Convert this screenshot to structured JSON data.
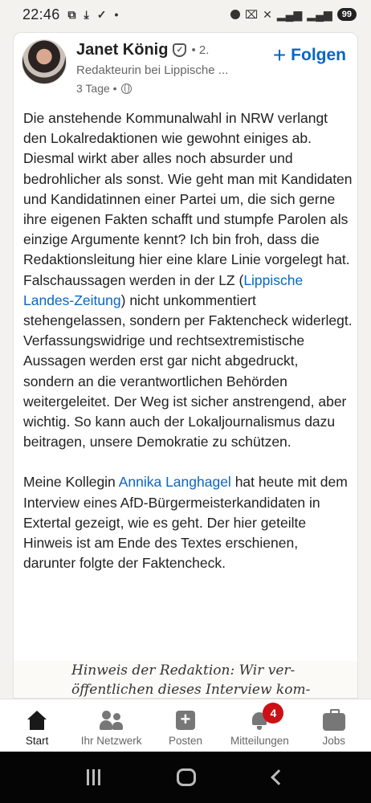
{
  "status_bar": {
    "time": "22:46",
    "battery": "99"
  },
  "post": {
    "author": {
      "name": "Janet König",
      "degree": "• 2.",
      "headline": "Redakteurin bei Lippische ...",
      "time": "3 Tage •"
    },
    "follow_label": "Folgen",
    "text": {
      "p1_a": "Die anstehende Kommunalwahl in NRW verlangt den Lokalredaktionen wie gewohnt einiges ab. Diesmal wirkt aber alles noch absurder und bedrohlicher als sonst. Wie geht man mit Kandidaten und Kandidatinnen einer Partei um, die sich gerne ihre eigenen Fakten schafft und stumpfe Parolen als einzige Argumente kennt? Ich bin froh, dass die Redaktionsleitung hier eine klare Linie vorgelegt hat. Falschaussagen werden in der LZ (",
      "p1_link": "Lippische Landes-Zeitung",
      "p1_b": ") nicht unkommentiert stehengelassen, sondern per Faktencheck widerlegt. Verfassungswidrige und rechtsextremistische Aussagen werden erst gar nicht abgedruckt, sondern an die verantwortlichen Behörden weitergeleitet. Der Weg ist sicher anstrengend, aber wichtig. So kann auch der Lokaljournalismus dazu beitragen, unsere Demokratie zu schützen.",
      "p2_a": "Meine Kollegin ",
      "p2_link": "Annika Langhagel",
      "p2_b": " hat heute mit dem Interview eines AfD-Bürgermeisterkandidaten in Extertal gezeigt, wie es geht. Der hier geteilte Hinweis ist am Ende des Textes erschienen, darunter folgte der Faktencheck."
    },
    "image_text": {
      "line1": "Hinweis der Redaktion: Wir ver-",
      "line2": "öffentlichen dieses Interview kom-"
    }
  },
  "bottom_nav": {
    "items": [
      {
        "label": "Start"
      },
      {
        "label": "Ihr Netzwerk"
      },
      {
        "label": "Posten"
      },
      {
        "label": "Mitteilungen"
      },
      {
        "label": "Jobs"
      }
    ],
    "notifications_badge": "4"
  }
}
